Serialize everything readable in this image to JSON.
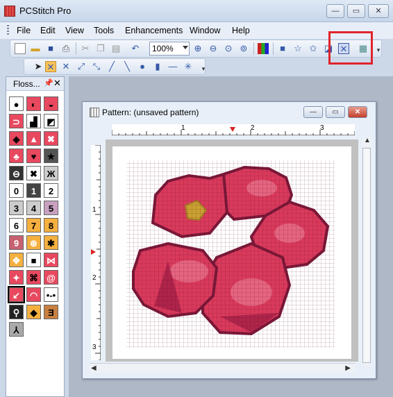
{
  "app": {
    "title": "PCStitch Pro"
  },
  "menu": {
    "items": [
      "File",
      "Edit",
      "View",
      "Tools",
      "Enhancements",
      "Window",
      "Help"
    ]
  },
  "toolbar": {
    "zoom_value": "100%"
  },
  "floss_panel": {
    "title": "Floss...",
    "pin_icon": "pin-icon",
    "close_label": "✕",
    "symbols": [
      "●",
      "◐",
      "◒",
      "⊃",
      "▟",
      "◩",
      "◈",
      "▲",
      "✖",
      "♣",
      "♥",
      "★",
      "⊖",
      "✖",
      "Ж",
      "0",
      "1",
      "2",
      "3",
      "4",
      "5",
      "6",
      "7",
      "8",
      "9",
      "⊛",
      "✱",
      "✥",
      "■",
      "⋈",
      "✦",
      "⌘",
      "@",
      "↙",
      "◠",
      "•-•",
      "⚲",
      "◆",
      "Ǝ",
      "⅄"
    ]
  },
  "pattern_window": {
    "title": "Pattern: (unsaved pattern)",
    "ruler_h": [
      "1",
      "2",
      "3"
    ],
    "ruler_v": [
      "1",
      "2",
      "3"
    ]
  },
  "colors": {
    "accent_highlight": "#e0242b",
    "flower_main": "#d93a5c",
    "flower_dark": "#8a1d3c",
    "flower_light": "#e8708a",
    "flower_center": "#c9a132"
  }
}
